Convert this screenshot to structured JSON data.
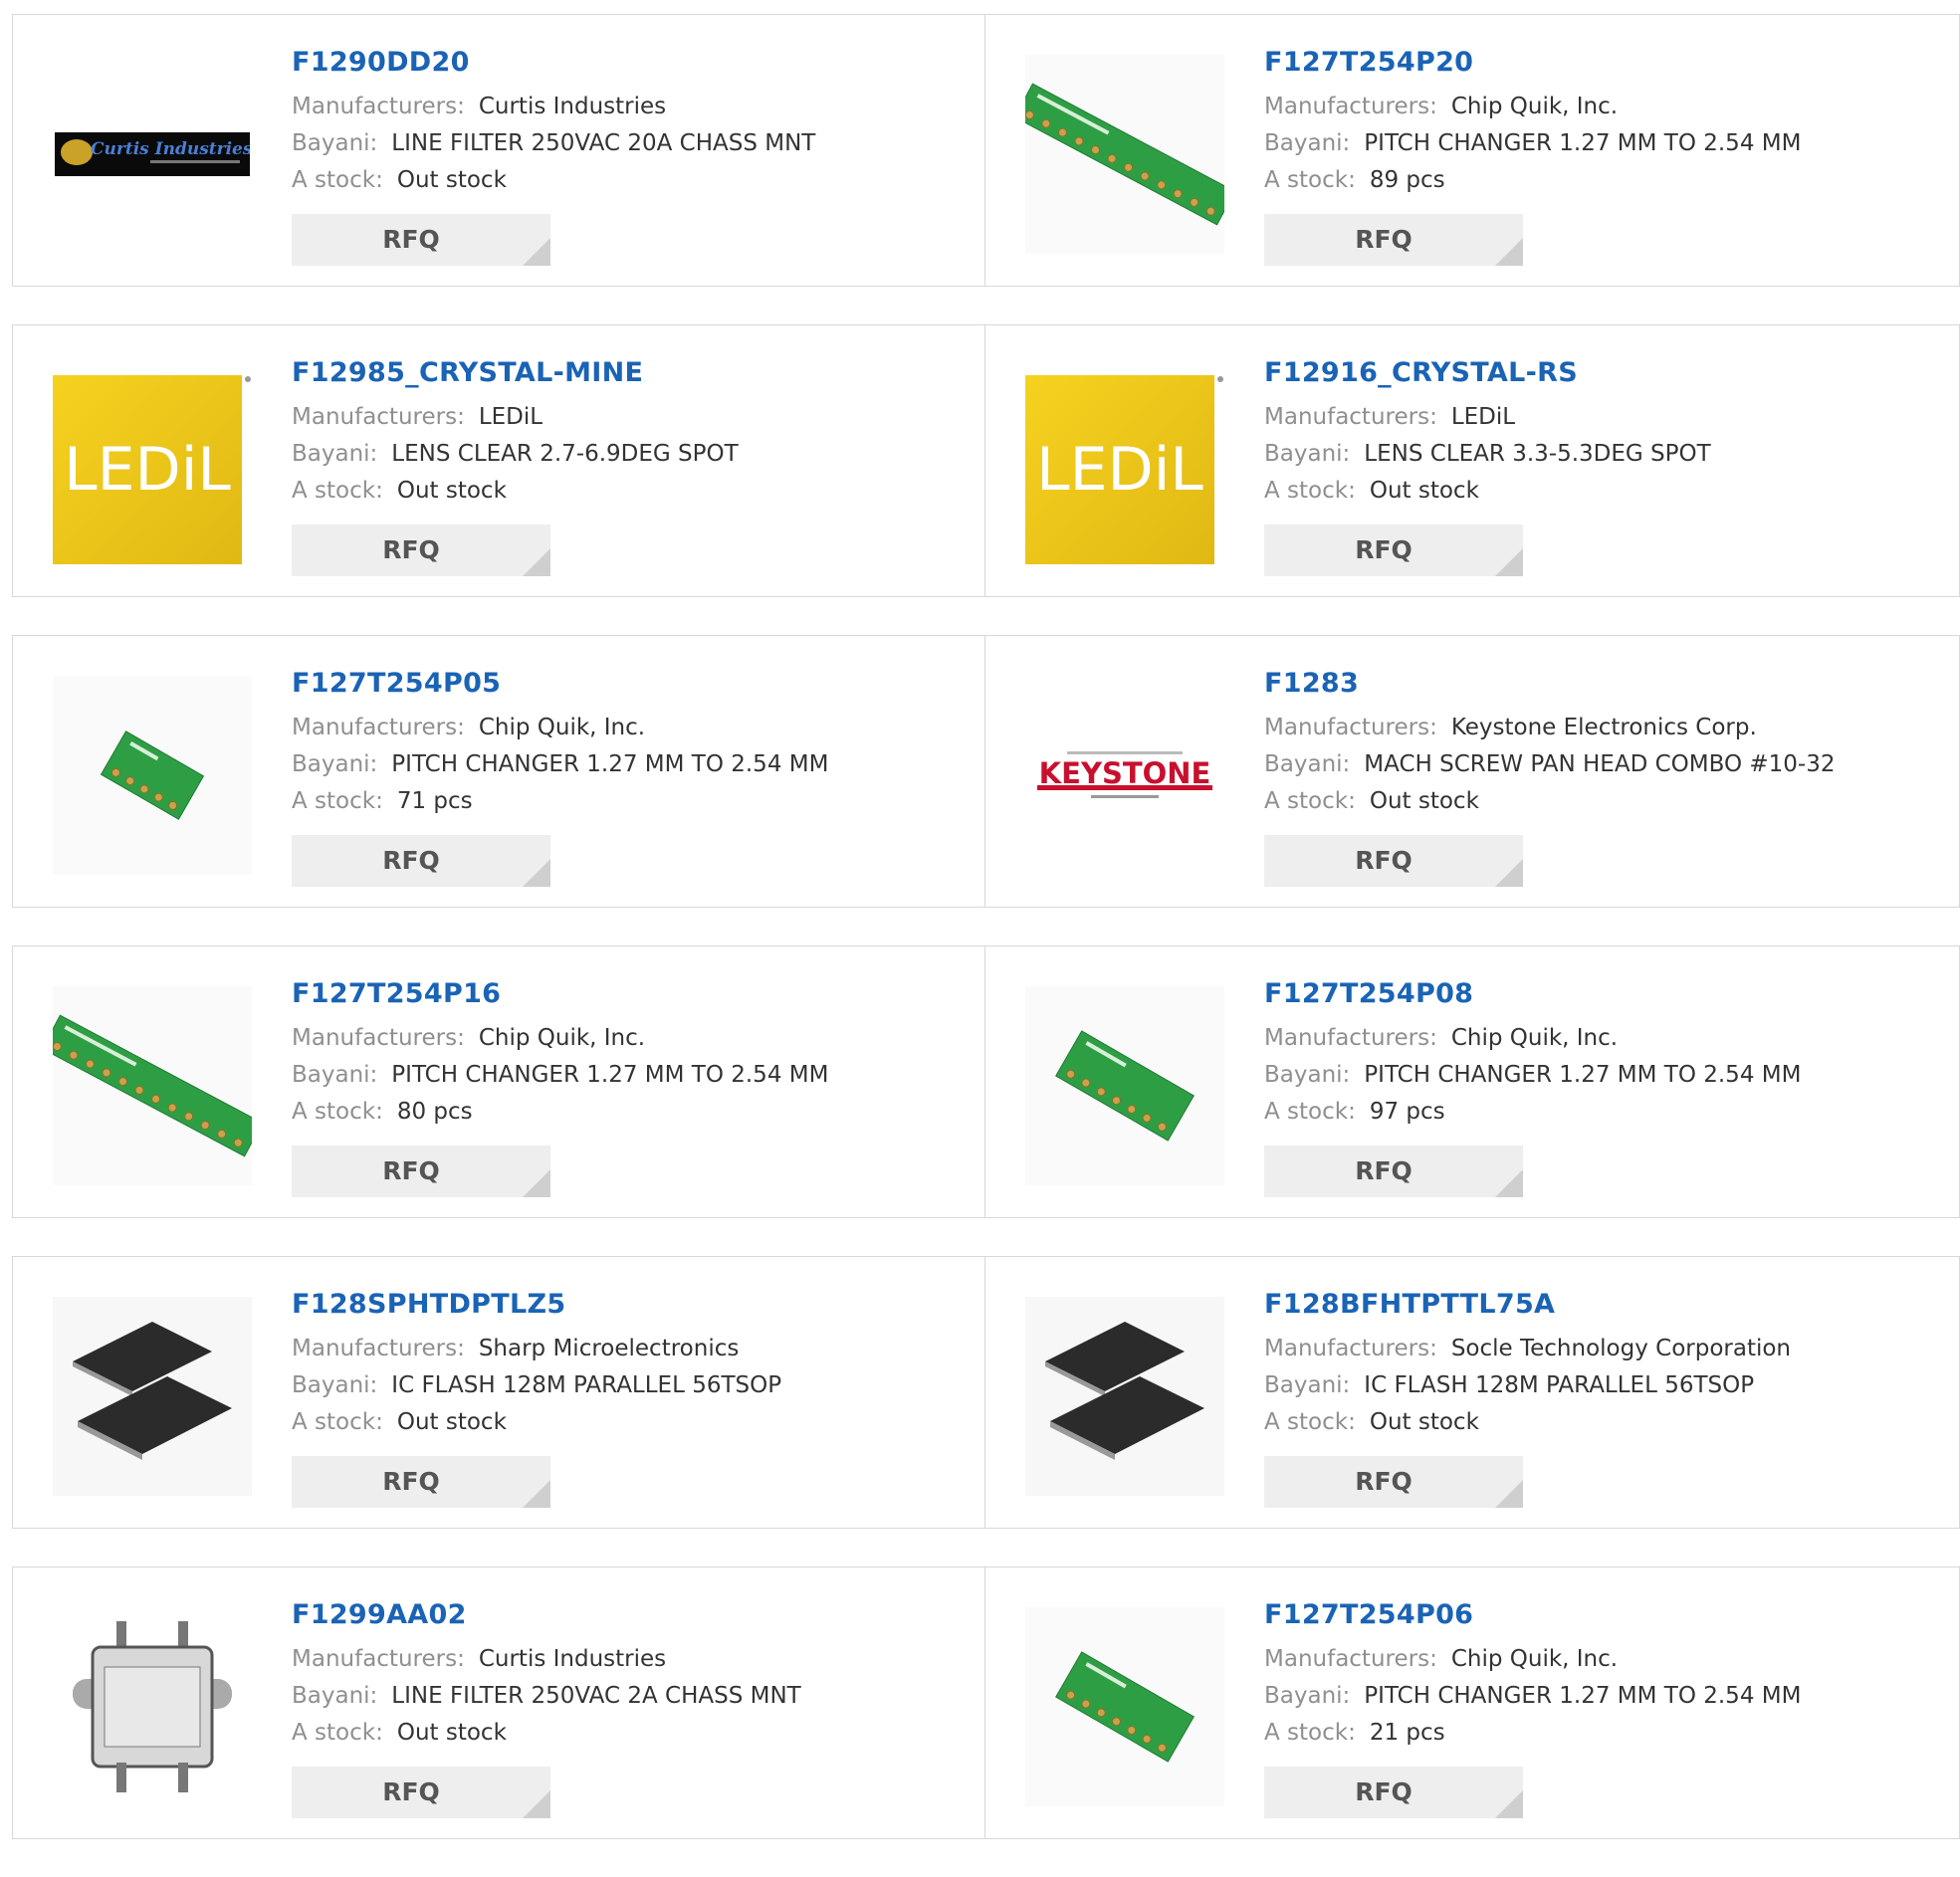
{
  "labels": {
    "manufacturer": "Manufacturers:",
    "description": "Bayani:",
    "stock": "A stock:",
    "rfq": "RFQ"
  },
  "products": [
    {
      "part": "F1290DD20",
      "manufacturer": "Curtis Industries",
      "description": "LINE FILTER 250VAC 20A CHASS MNT",
      "stock": "Out stock",
      "image": "curtis-logo"
    },
    {
      "part": "F127T254P20",
      "manufacturer": "Chip Quik, Inc.",
      "description": "PITCH CHANGER 1.27 MM TO 2.54 MM",
      "stock": "89 pcs",
      "image": "pcb-long"
    },
    {
      "part": "F12985_CRYSTAL-MINE",
      "manufacturer": "LEDiL",
      "description": "LENS CLEAR 2.7-6.9DEG SPOT",
      "stock": "Out stock",
      "image": "ledil-logo"
    },
    {
      "part": "F12916_CRYSTAL-RS",
      "manufacturer": "LEDiL",
      "description": "LENS CLEAR 3.3-5.3DEG SPOT",
      "stock": "Out stock",
      "image": "ledil-logo"
    },
    {
      "part": "F127T254P05",
      "manufacturer": "Chip Quik, Inc.",
      "description": "PITCH CHANGER 1.27 MM TO 2.54 MM",
      "stock": "71 pcs",
      "image": "pcb-small"
    },
    {
      "part": "F1283",
      "manufacturer": "Keystone Electronics Corp.",
      "description": "MACH SCREW PAN HEAD COMBO #10-32",
      "stock": "Out stock",
      "image": "keystone-logo"
    },
    {
      "part": "F127T254P16",
      "manufacturer": "Chip Quik, Inc.",
      "description": "PITCH CHANGER 1.27 MM TO 2.54 MM",
      "stock": "80 pcs",
      "image": "pcb-long"
    },
    {
      "part": "F127T254P08",
      "manufacturer": "Chip Quik, Inc.",
      "description": "PITCH CHANGER 1.27 MM TO 2.54 MM",
      "stock": "97 pcs",
      "image": "pcb-medium"
    },
    {
      "part": "F128SPHTDPTLZ5",
      "manufacturer": "Sharp Microelectronics",
      "description": "IC FLASH 128M PARALLEL 56TSOP",
      "stock": "Out stock",
      "image": "tsop-chips"
    },
    {
      "part": "F128BFHTPTTL75A",
      "manufacturer": "Socle Technology Corporation",
      "description": "IC FLASH 128M PARALLEL 56TSOP",
      "stock": "Out stock",
      "image": "tsop-chips"
    },
    {
      "part": "F1299AA02",
      "manufacturer": "Curtis Industries",
      "description": "LINE FILTER 250VAC 2A CHASS MNT",
      "stock": "Out stock",
      "image": "line-filter"
    },
    {
      "part": "F127T254P06",
      "manufacturer": "Chip Quik, Inc.",
      "description": "PITCH CHANGER 1.27 MM TO 2.54 MM",
      "stock": "21 pcs",
      "image": "pcb-medium"
    }
  ],
  "image_text": {
    "curtis": "Curtis Industries",
    "ledil": "LEDiL",
    "keystone": "KEYSTONE"
  },
  "colors": {
    "link": "#1a63b5",
    "label": "#8f8f8f",
    "button_bg": "#eeeeee",
    "pcb": "#2e9e45",
    "ledil_yellow": "#f2c81a"
  }
}
